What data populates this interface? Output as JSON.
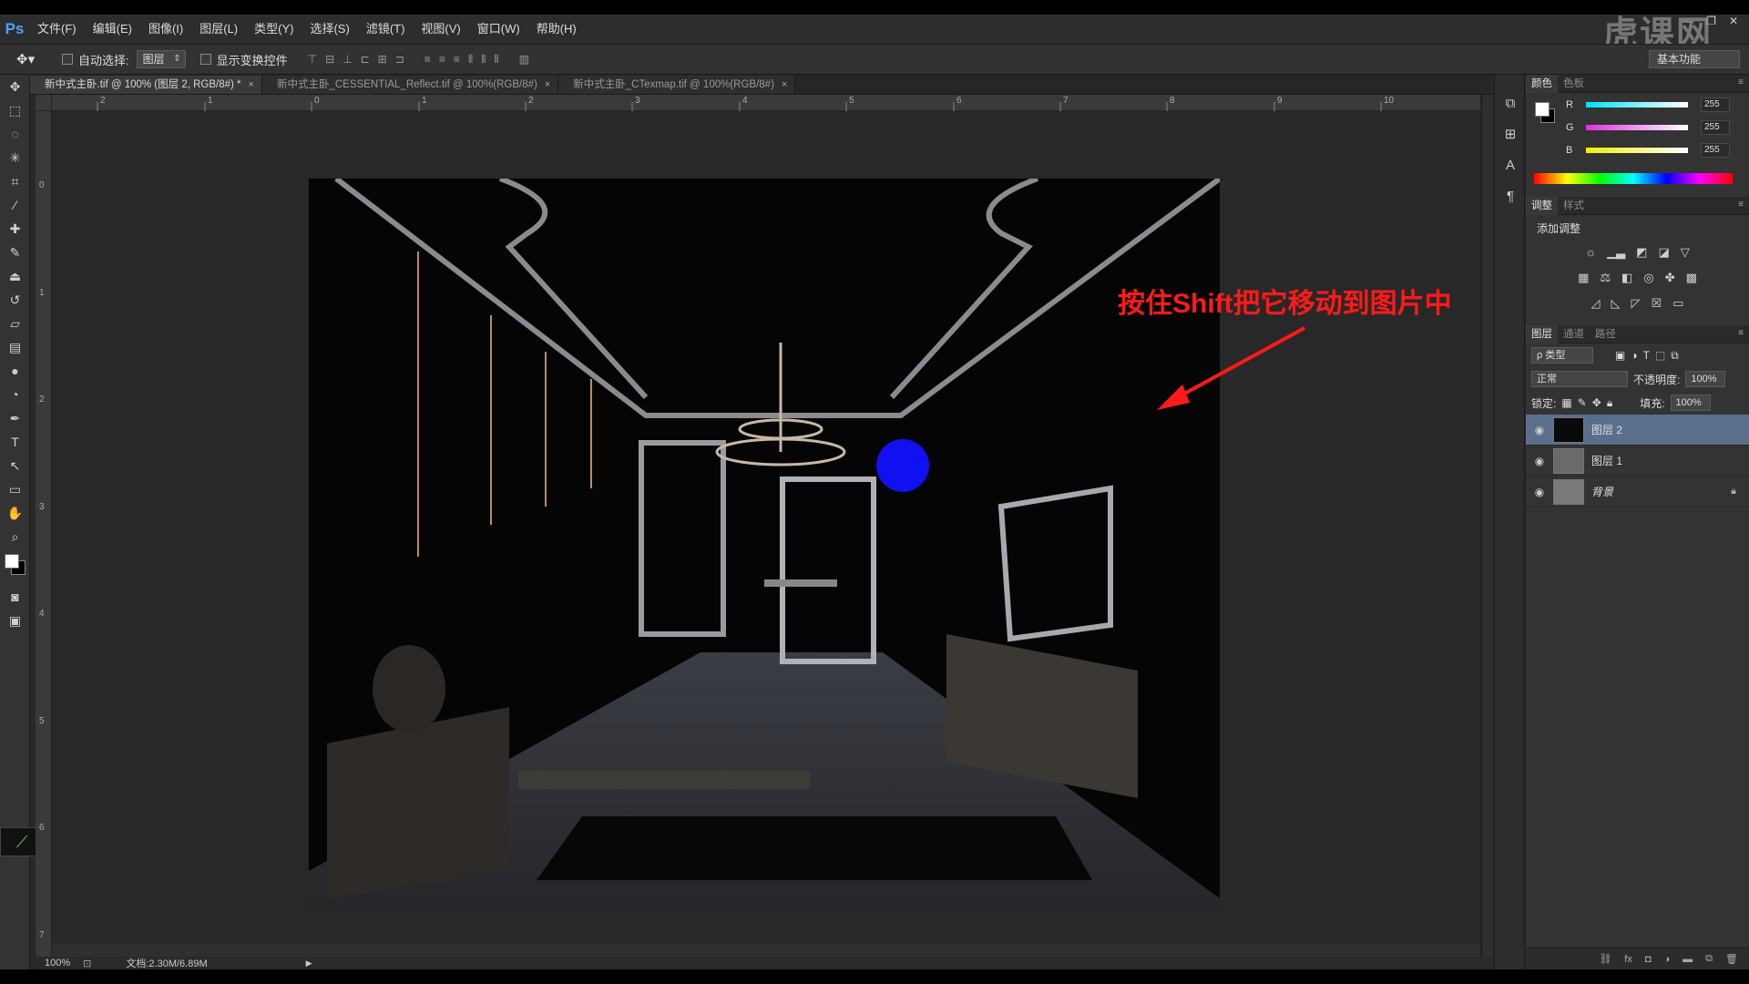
{
  "menubar": {
    "logo": "Ps",
    "items": [
      "文件(F)",
      "编辑(E)",
      "图像(I)",
      "图层(L)",
      "类型(Y)",
      "选择(S)",
      "滤镜(T)",
      "视图(V)",
      "窗口(W)",
      "帮助(H)"
    ],
    "watermark": "虎课网"
  },
  "options": {
    "auto_select_label": "自动选择:",
    "auto_select_value": "图层",
    "show_transform_label": "显示变换控件",
    "workspace": "基本功能"
  },
  "tabs": [
    {
      "label": "新中式主卧.tif @ 100% (图层 2, RGB/8#) *",
      "active": true
    },
    {
      "label": "新中式主卧_CESSENTIAL_Reflect.tif @ 100%(RGB/8#)",
      "active": false
    },
    {
      "label": "新中式主卧_CTexmap.tif @ 100%(RGB/8#)",
      "active": false
    }
  ],
  "ruler": {
    "h_ticks": [
      "2",
      "1",
      "0",
      "1",
      "2",
      "3",
      "4",
      "5",
      "6",
      "7",
      "8",
      "9",
      "10"
    ],
    "v_ticks": [
      "0",
      "1",
      "2",
      "3",
      "4",
      "5",
      "6",
      "7"
    ]
  },
  "annotation": "按住Shift把它移动到图片中",
  "status": {
    "zoom": "100%",
    "doc": "文档:2.30M/6.89M"
  },
  "color_panel": {
    "tabs": [
      "颜色",
      "色板"
    ],
    "channels": [
      {
        "label": "R",
        "value": "255",
        "color": "#00e0ff"
      },
      {
        "label": "G",
        "value": "255",
        "color": "#e030e0"
      },
      {
        "label": "B",
        "value": "255",
        "color": "#f0f000"
      }
    ]
  },
  "adjust_panel": {
    "tabs": [
      "调整",
      "样式"
    ],
    "title": "添加调整"
  },
  "layers_panel": {
    "tabs": [
      "图层",
      "通道",
      "路径"
    ],
    "kind": "ρ 类型",
    "blend_mode": "正常",
    "opacity_label": "不透明度:",
    "opacity": "100%",
    "lock_label": "锁定:",
    "fill_label": "填充:",
    "fill": "100%",
    "layers": [
      {
        "name": "图层 2",
        "selected": true
      },
      {
        "name": "图层 1",
        "selected": false
      },
      {
        "name": "背景",
        "selected": false
      }
    ]
  }
}
